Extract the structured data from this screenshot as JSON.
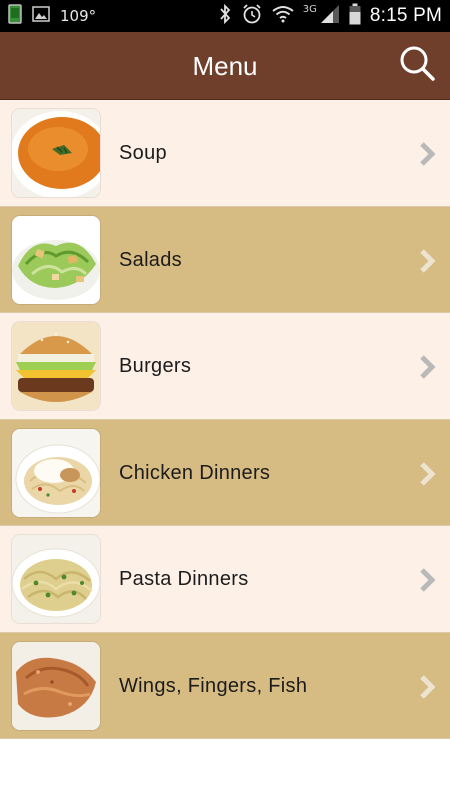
{
  "status_bar": {
    "temperature": "109°",
    "network": "3G",
    "time": "8:15 PM",
    "icons": [
      "sim-icon",
      "image-icon",
      "bluetooth-icon",
      "alarm-icon",
      "wifi-icon",
      "signal-icon",
      "battery-icon"
    ]
  },
  "header": {
    "title": "Menu",
    "background": "#6f3f2c",
    "search_icon": "search-icon"
  },
  "menu": {
    "row_colors": [
      "#fdf0e7",
      "#d6bb83"
    ],
    "items": [
      {
        "label": "Soup",
        "thumbnail": "soup-bowl"
      },
      {
        "label": "Salads",
        "thumbnail": "caesar-salad"
      },
      {
        "label": "Burgers",
        "thumbnail": "cheeseburger"
      },
      {
        "label": "Chicken Dinners",
        "thumbnail": "chicken-pasta"
      },
      {
        "label": "Pasta Dinners",
        "thumbnail": "spaghetti"
      },
      {
        "label": "Wings, Fingers, Fish",
        "thumbnail": "fried-chicken"
      }
    ]
  }
}
